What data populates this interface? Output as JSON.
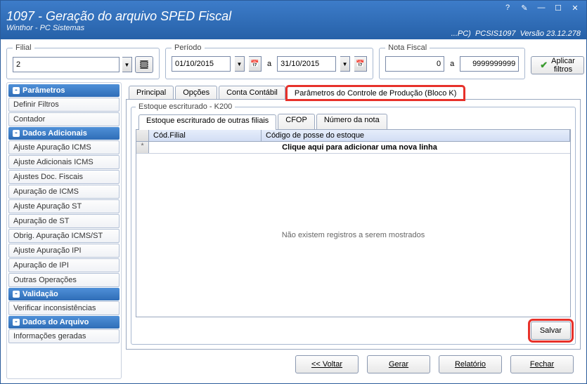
{
  "window": {
    "title": "1097 - Geração do arquivo SPED Fiscal",
    "subtitle": "Winthor - PC Sistemas",
    "meta_prefix": "...PC)",
    "code": "PCSIS1097",
    "version": "Versão 23.12.278"
  },
  "icons": {
    "help": "?",
    "edit": "✎",
    "min": "—",
    "max": "☐",
    "close": "✕"
  },
  "filial": {
    "legend": "Filial",
    "value": "2",
    "gear": "⚙"
  },
  "periodo": {
    "legend": "Período",
    "from": "01/10/2015",
    "to": "31/10/2015",
    "sep": "a"
  },
  "nota": {
    "legend": "Nota Fiscal",
    "from": "0",
    "to": "9999999999",
    "sep": "a"
  },
  "aplicar": {
    "label": "Aplicar filtros"
  },
  "sidebar": {
    "parametros": {
      "header": "Parâmetros",
      "items": [
        "Definir Filtros",
        "Contador"
      ]
    },
    "dados_adicionais": {
      "header": "Dados Adicionais",
      "items": [
        "Ajuste Apuração ICMS",
        "Ajuste Adicionais ICMS",
        "Ajustes Doc. Fiscais",
        "Apuração de ICMS",
        "Ajuste Apuração ST",
        "Apuração de ST",
        "Obrig. Apuração ICMS/ST",
        "Ajuste Apuração IPI",
        "Apuração de IPI",
        "Outras Operações"
      ]
    },
    "validacao": {
      "header": "Validação",
      "items": [
        "Verificar inconsistências"
      ]
    },
    "dados_arquivo": {
      "header": "Dados do Arquivo",
      "items": [
        "Informações geradas"
      ]
    }
  },
  "tabs": {
    "principal": "Principal",
    "opcoes": "Opções",
    "conta": "Conta Contábil",
    "param_prod": "Parâmetros do Controle de Produção (Bloco K)"
  },
  "estoque": {
    "legend": "Estoque escriturado - K200",
    "subtabs": {
      "outras": "Estoque escriturado de outras filiais",
      "cfop": "CFOP",
      "numero": "Número da nota"
    },
    "cols": {
      "filial": "Cód.Filial",
      "codigo": "Código de posse do estoque"
    },
    "addrow_marker": "*",
    "addrow": "Clique aqui para adicionar uma nova linha",
    "empty": "Não existem registros a serem mostrados"
  },
  "buttons": {
    "salvar": "Salvar",
    "voltar": "<< Voltar",
    "gerar": "Gerar",
    "relatorio": "Relatório",
    "fechar": "Fechar"
  }
}
